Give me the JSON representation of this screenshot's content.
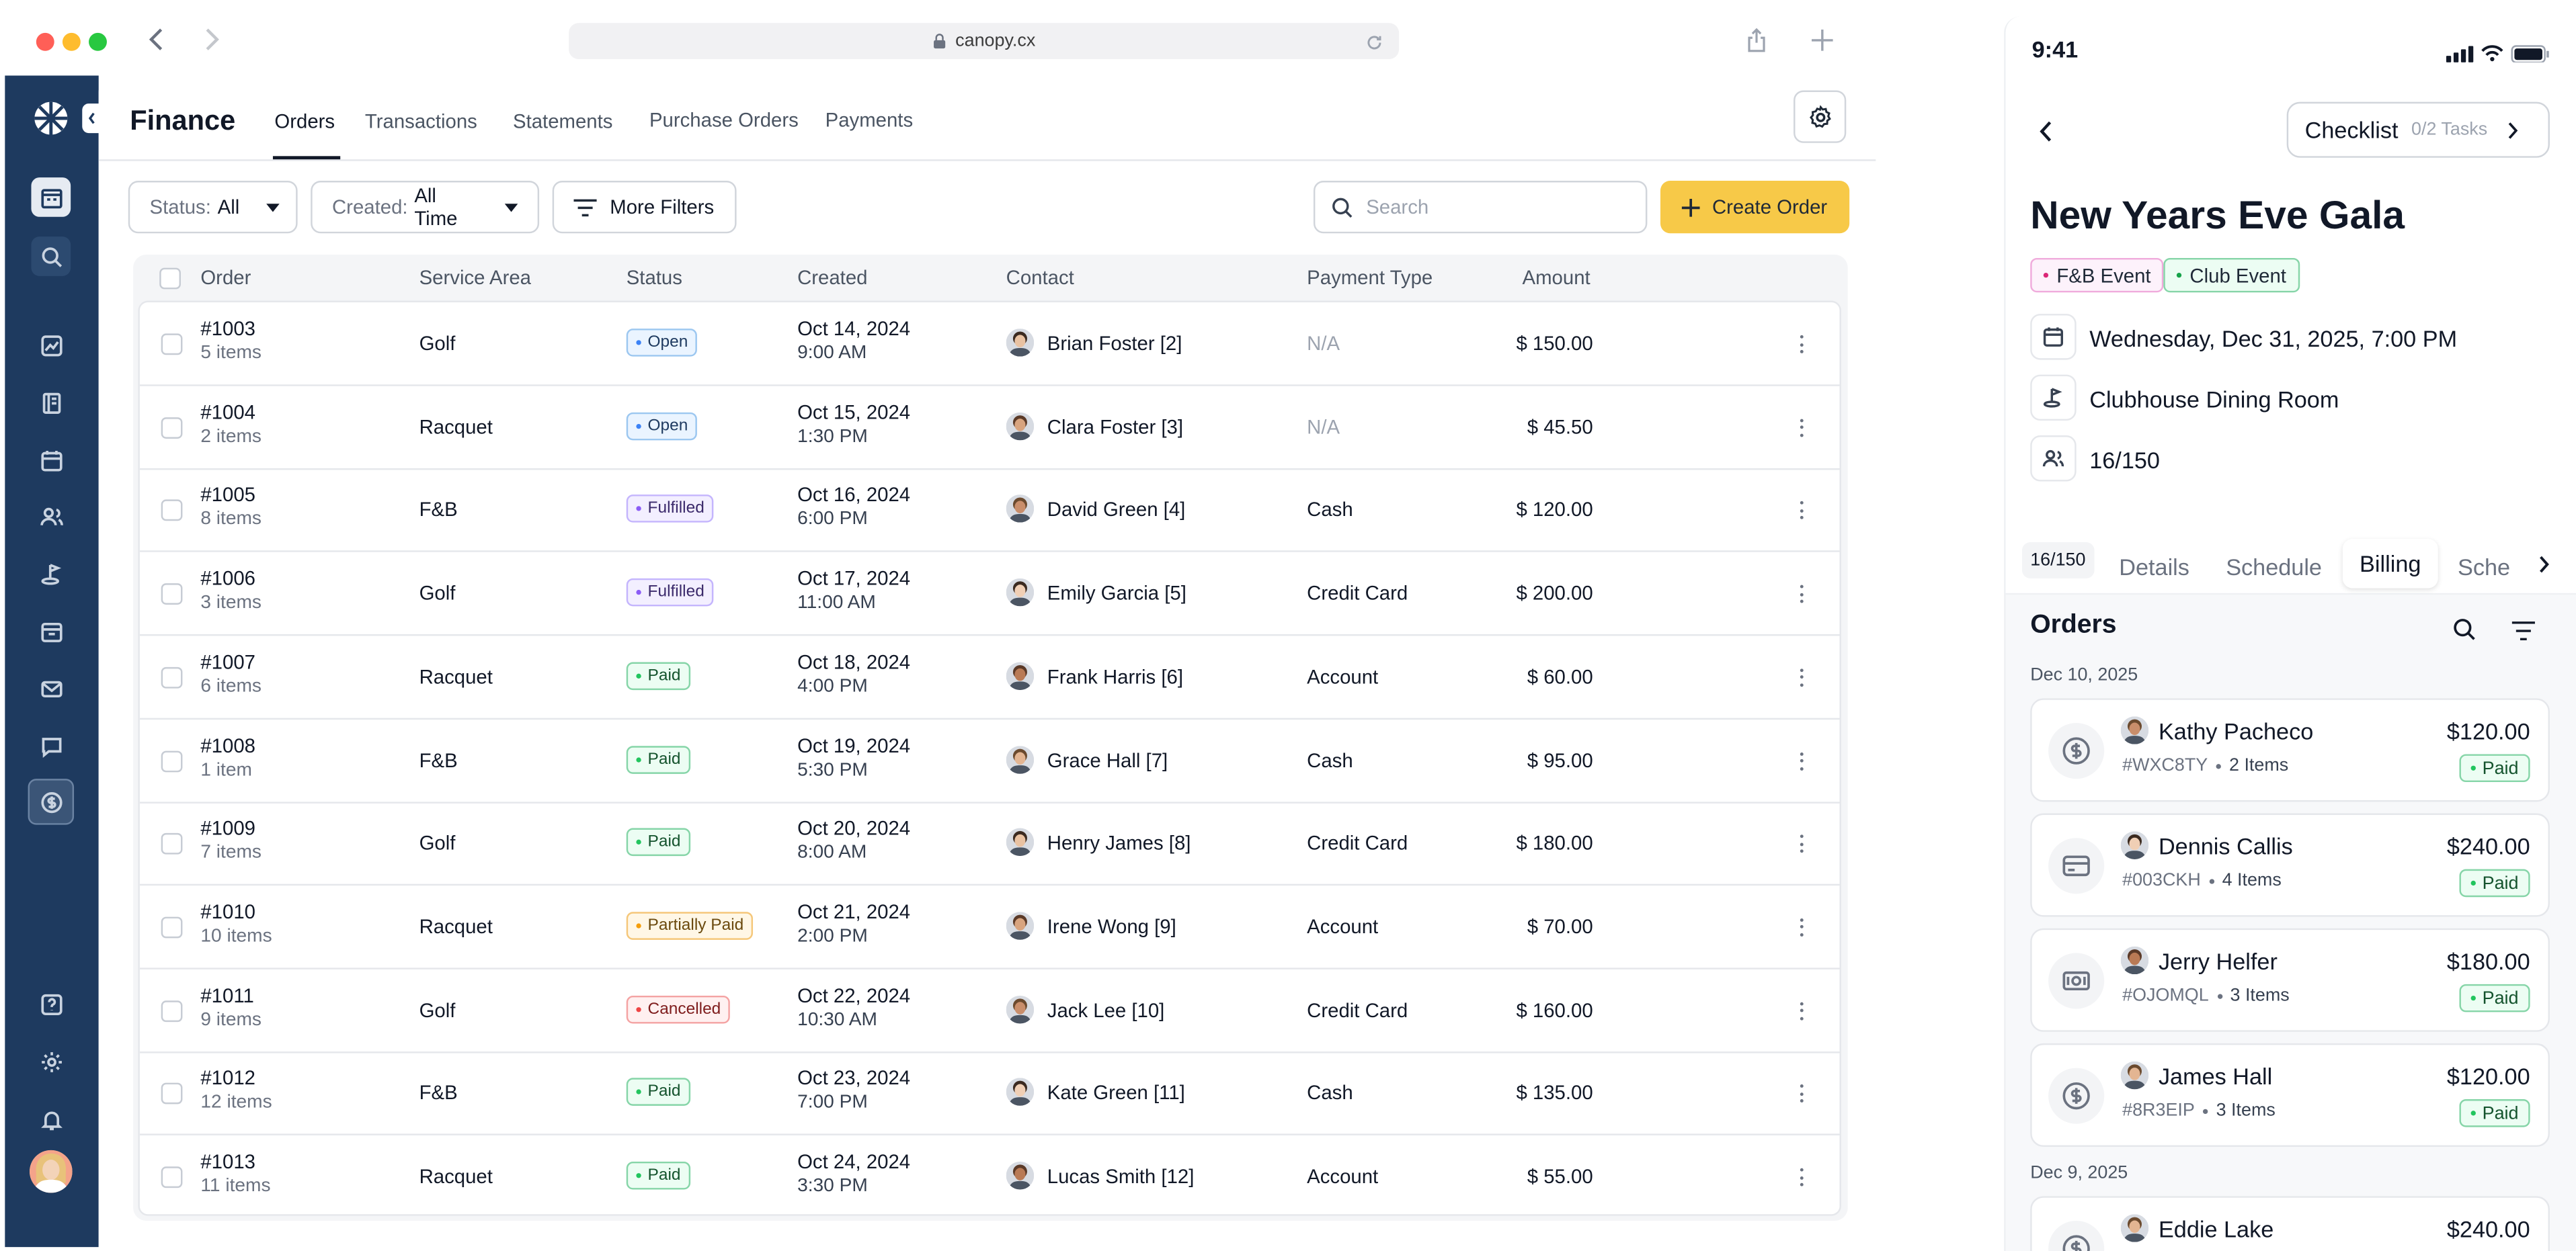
{
  "browser": {
    "url": "canopy.cx",
    "traffic_lights": [
      "#ff5f57",
      "#febc2e",
      "#28c840"
    ]
  },
  "app": {
    "section_title": "Finance",
    "tabs": [
      {
        "label": "Orders",
        "active": true
      },
      {
        "label": "Transactions",
        "active": false
      },
      {
        "label": "Statements",
        "active": false
      },
      {
        "label": "Purchase Orders",
        "active": false
      },
      {
        "label": "Payments",
        "active": false
      }
    ],
    "filters": {
      "status": {
        "label": "Status:",
        "value": "All"
      },
      "created": {
        "label": "Created:",
        "value": "All Time"
      },
      "more": "More Filters"
    },
    "search_placeholder": "Search",
    "create_button": "Create Order",
    "accent": "#f7c948",
    "rail_color": "#1e3a5f"
  },
  "table": {
    "columns": [
      "Order",
      "Service Area",
      "Status",
      "Created",
      "Contact",
      "Payment Type",
      "Amount"
    ],
    "rows": [
      {
        "order": "#1003",
        "items": "5 items",
        "area": "Golf",
        "status": "Open",
        "date": "Oct 14, 2024",
        "time": "9:00 AM",
        "contact": "Brian Foster [2]",
        "payment": "N/A",
        "amount": "$ 150.00"
      },
      {
        "order": "#1004",
        "items": "2 items",
        "area": "Racquet",
        "status": "Open",
        "date": "Oct 15, 2024",
        "time": "1:30 PM",
        "contact": "Clara Foster [3]",
        "payment": "N/A",
        "amount": "$ 45.50"
      },
      {
        "order": "#1005",
        "items": "8 items",
        "area": "F&B",
        "status": "Fulfilled",
        "date": "Oct 16, 2024",
        "time": "6:00 PM",
        "contact": "David Green [4]",
        "payment": "Cash",
        "amount": "$ 120.00"
      },
      {
        "order": "#1006",
        "items": "3 items",
        "area": "Golf",
        "status": "Fulfilled",
        "date": "Oct 17, 2024",
        "time": "11:00 AM",
        "contact": "Emily Garcia [5]",
        "payment": "Credit Card",
        "amount": "$ 200.00"
      },
      {
        "order": "#1007",
        "items": "6 items",
        "area": "Racquet",
        "status": "Paid",
        "date": "Oct 18, 2024",
        "time": "4:00 PM",
        "contact": "Frank Harris [6]",
        "payment": "Account",
        "amount": "$ 60.00"
      },
      {
        "order": "#1008",
        "items": "1 item",
        "area": "F&B",
        "status": "Paid",
        "date": "Oct 19, 2024",
        "time": "5:30 PM",
        "contact": "Grace Hall [7]",
        "payment": "Cash",
        "amount": "$ 95.00"
      },
      {
        "order": "#1009",
        "items": "7 items",
        "area": "Golf",
        "status": "Paid",
        "date": "Oct 20, 2024",
        "time": "8:00 AM",
        "contact": "Henry James [8]",
        "payment": "Credit Card",
        "amount": "$ 180.00"
      },
      {
        "order": "#1010",
        "items": "10 items",
        "area": "Racquet",
        "status": "Partially Paid",
        "date": "Oct 21, 2024",
        "time": "2:00 PM",
        "contact": "Irene Wong [9]",
        "payment": "Account",
        "amount": "$ 70.00"
      },
      {
        "order": "#1011",
        "items": "9 items",
        "area": "Golf",
        "status": "Cancelled",
        "date": "Oct 22, 2024",
        "time": "10:30 AM",
        "contact": "Jack Lee [10]",
        "payment": "Credit Card",
        "amount": "$ 160.00"
      },
      {
        "order": "#1012",
        "items": "12 items",
        "area": "F&B",
        "status": "Paid",
        "date": "Oct 23, 2024",
        "time": "7:00 PM",
        "contact": "Kate Green [11]",
        "payment": "Cash",
        "amount": "$ 135.00"
      },
      {
        "order": "#1013",
        "items": "11 items",
        "area": "Racquet",
        "status": "Paid",
        "date": "Oct 24, 2024",
        "time": "3:30 PM",
        "contact": "Lucas Smith [12]",
        "payment": "Account",
        "amount": "$ 55.00"
      }
    ],
    "status_colors": {
      "Open": {
        "bg": "#eaf4ff",
        "border": "#9cc7f0",
        "text": "#1e3a5f",
        "dot": "#3b82f6"
      },
      "Fulfilled": {
        "bg": "#f3efff",
        "border": "#c4b5fd",
        "text": "#3b2a6b",
        "dot": "#8b5cf6"
      },
      "Paid": {
        "bg": "#ecfdf3",
        "border": "#86d5a8",
        "text": "#14532d",
        "dot": "#22c55e"
      },
      "Partially Paid": {
        "bg": "#fff7e6",
        "border": "#f5c77a",
        "text": "#6b4a0e",
        "dot": "#f59e0b"
      },
      "Cancelled": {
        "bg": "#fff0f0",
        "border": "#f4a3a3",
        "text": "#7f1d1d",
        "dot": "#ef4444"
      }
    }
  },
  "mobile": {
    "time": "9:41",
    "checklist_label": "Checklist",
    "checklist_count": "0/2 Tasks",
    "event_title": "New Years Eve Gala",
    "tags": [
      {
        "label": "F&B Event",
        "bg": "#fdf2fb",
        "border": "#f0abdc",
        "dot": "#db2777"
      },
      {
        "label": "Club Event",
        "bg": "#ecfdf3",
        "border": "#86d5a8",
        "dot": "#16a34a"
      }
    ],
    "date_line": "Wednesday, Dec 31, 2025, 7:00 PM",
    "location": "Clubhouse Dining Room",
    "capacity": "16/150",
    "tabs": [
      "16/150",
      "Details",
      "Schedule",
      "Billing",
      "Sche"
    ],
    "active_tab": "Billing",
    "orders_heading": "Orders",
    "groups": [
      {
        "date": "Dec 10, 2025",
        "orders": [
          {
            "icon": "dollar-circle-icon",
            "name": "Kathy Pacheco",
            "code": "#WXC8TY",
            "items": "2 Items",
            "amount": "$120.00",
            "status": "Paid"
          },
          {
            "icon": "credit-card-icon",
            "name": "Dennis Callis",
            "code": "#003CKH",
            "items": "4 Items",
            "amount": "$240.00",
            "status": "Paid"
          },
          {
            "icon": "cash-icon",
            "name": "Jerry Helfer",
            "code": "#OJOMQL",
            "items": "3 Items",
            "amount": "$180.00",
            "status": "Paid"
          },
          {
            "icon": "dollar-circle-icon",
            "name": "James Hall",
            "code": "#8R3EIP",
            "items": "3 Items",
            "amount": "$120.00",
            "status": "Paid"
          }
        ]
      },
      {
        "date": "Dec 9, 2025",
        "orders": [
          {
            "icon": "dollar-circle-icon",
            "name": "Eddie Lake",
            "amount": "$240.00"
          }
        ]
      }
    ]
  }
}
